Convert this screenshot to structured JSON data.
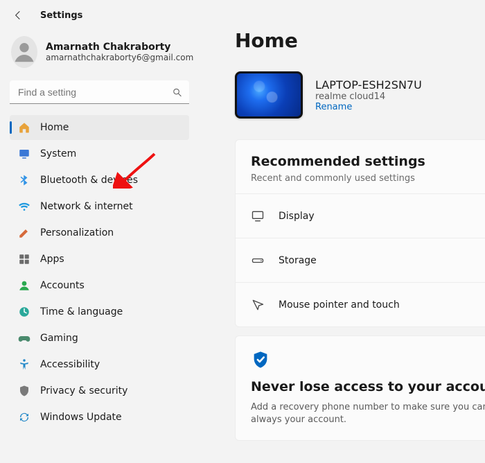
{
  "window": {
    "title": "Settings"
  },
  "profile": {
    "name": "Amarnath Chakraborty",
    "email": "amarnathchakraborty6@gmail.com"
  },
  "search": {
    "placeholder": "Find a setting"
  },
  "nav": {
    "items": [
      {
        "icon": "home",
        "label": "Home",
        "selected": true
      },
      {
        "icon": "system",
        "label": "System",
        "selected": false
      },
      {
        "icon": "bluetooth",
        "label": "Bluetooth & devices",
        "selected": false
      },
      {
        "icon": "network",
        "label": "Network & internet",
        "selected": false
      },
      {
        "icon": "personalization",
        "label": "Personalization",
        "selected": false
      },
      {
        "icon": "apps",
        "label": "Apps",
        "selected": false
      },
      {
        "icon": "accounts",
        "label": "Accounts",
        "selected": false
      },
      {
        "icon": "time",
        "label": "Time & language",
        "selected": false
      },
      {
        "icon": "gaming",
        "label": "Gaming",
        "selected": false
      },
      {
        "icon": "accessibility",
        "label": "Accessibility",
        "selected": false
      },
      {
        "icon": "privacy",
        "label": "Privacy & security",
        "selected": false
      },
      {
        "icon": "update",
        "label": "Windows Update",
        "selected": false
      }
    ]
  },
  "page": {
    "title": "Home",
    "device": {
      "name": "LAPTOP-ESH2SN7U",
      "model": "realme cloud14",
      "rename": "Rename"
    },
    "recommended": {
      "title": "Recommended settings",
      "subtitle": "Recent and commonly used settings",
      "rows": [
        {
          "icon": "display",
          "label": "Display"
        },
        {
          "icon": "storage",
          "label": "Storage"
        },
        {
          "icon": "mouse",
          "label": "Mouse pointer and touch"
        }
      ]
    },
    "account_card": {
      "title": "Never lose access to your account",
      "body": "Add a recovery phone number to make sure you can always your account."
    }
  },
  "icon_colors": {
    "home": "#e8a23a",
    "system": "#3b78d6",
    "bluetooth": "#3394e6",
    "network": "#1f9ae0",
    "personalization": "#d66a3a",
    "apps": "#6b6b6b",
    "accounts": "#2aa84f",
    "time": "#2aa89a",
    "gaming": "#4a8a6d",
    "accessibility": "#1f86c7",
    "privacy": "#7a7a7a",
    "update": "#1f86c7",
    "shield": "#0067c0"
  },
  "annotation": {
    "arrow_target": "Bluetooth & devices",
    "color": "#e11"
  }
}
